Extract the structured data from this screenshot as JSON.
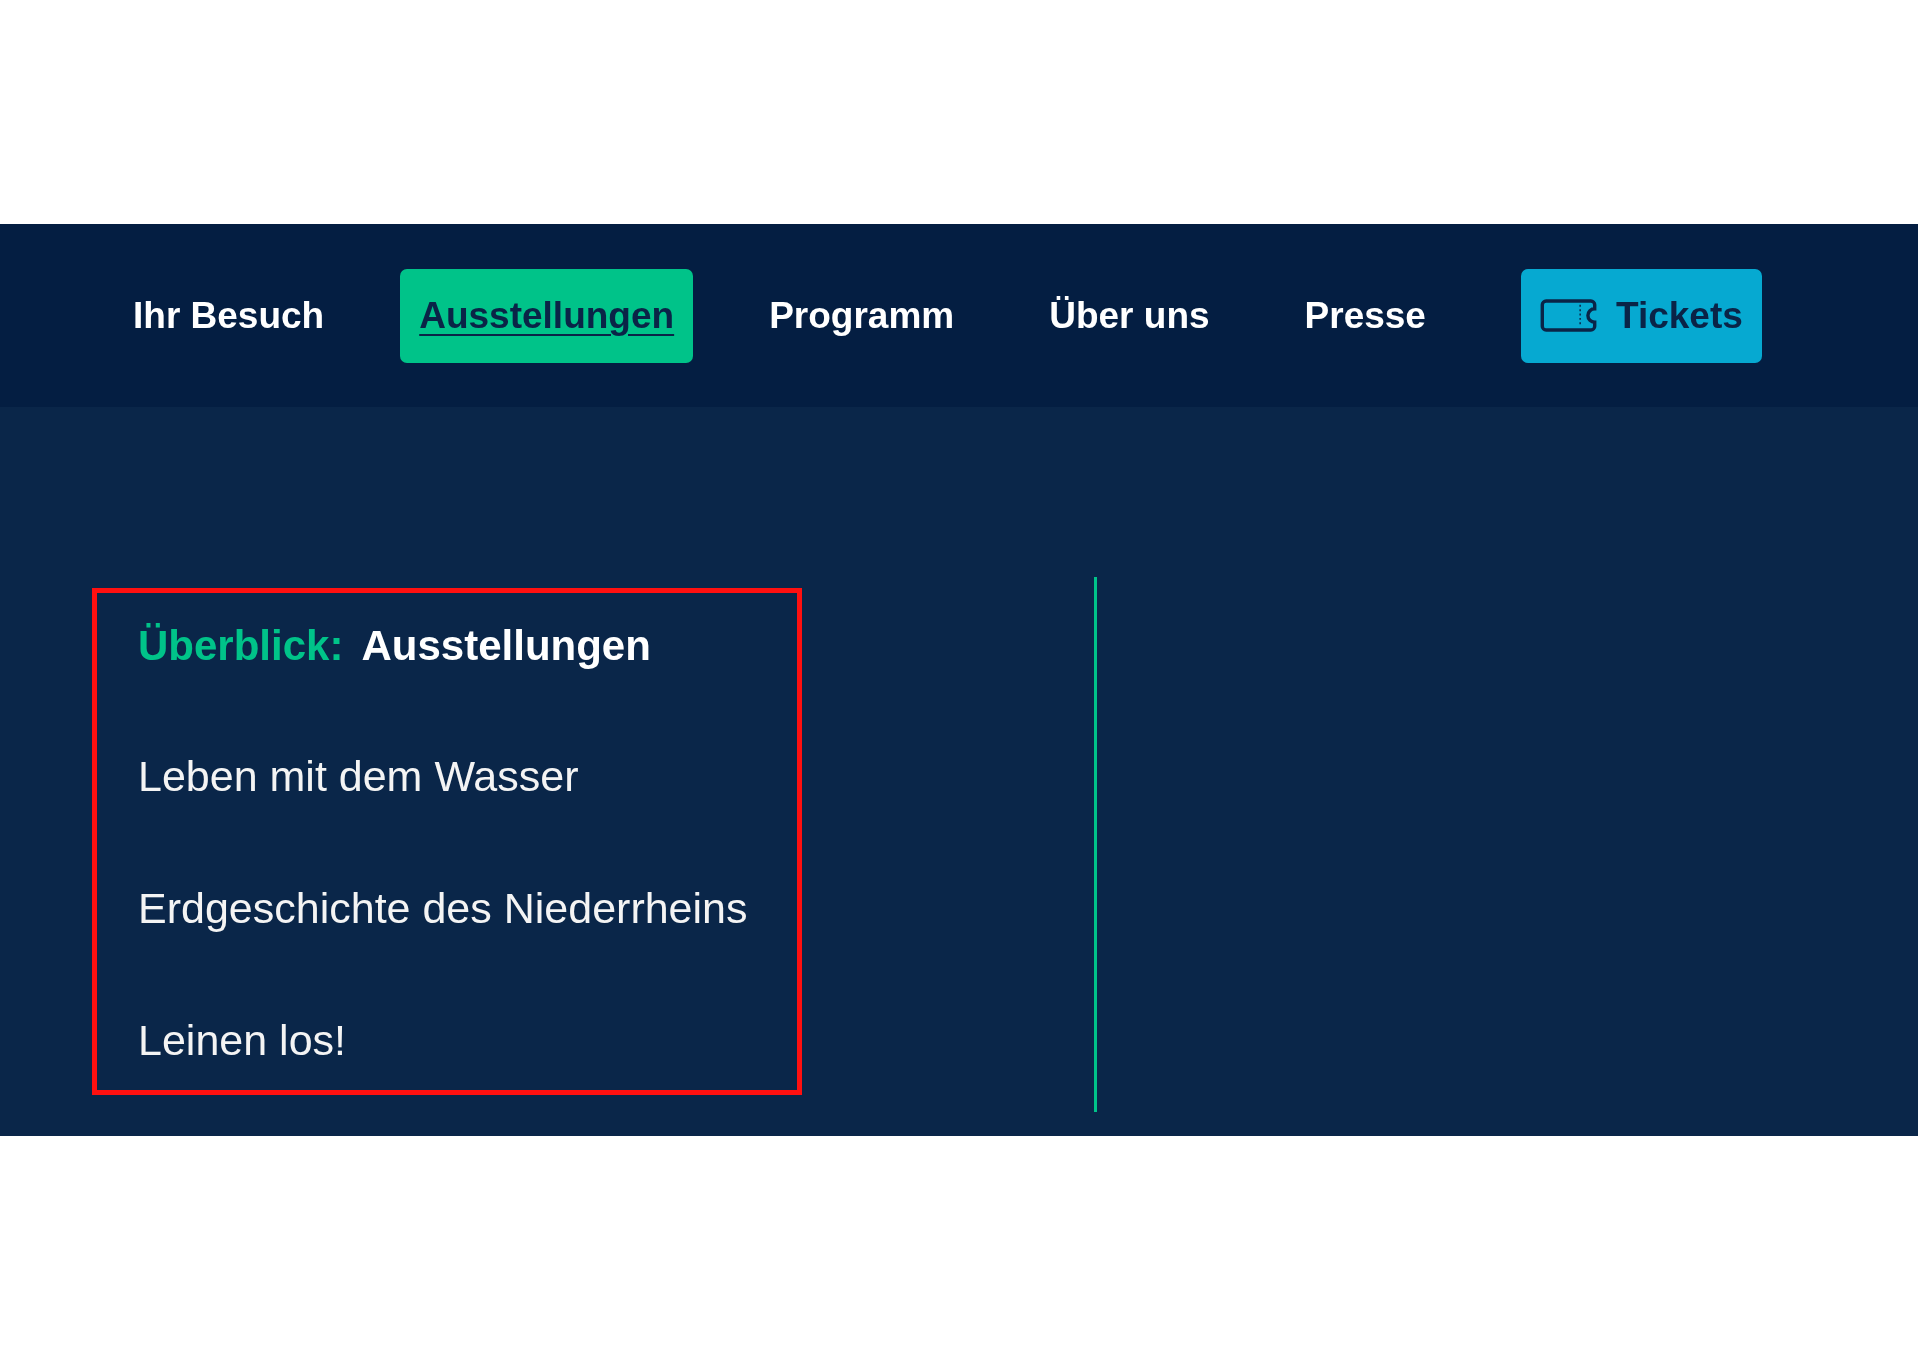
{
  "nav": {
    "items": [
      {
        "label": "Ihr Besuch",
        "selected": false
      },
      {
        "label": "Ausstellungen",
        "selected": true
      },
      {
        "label": "Programm",
        "selected": false
      },
      {
        "label": "Über uns",
        "selected": false
      },
      {
        "label": "Presse",
        "selected": false
      }
    ]
  },
  "tickets_button": {
    "label": "Tickets"
  },
  "submenu": {
    "highlighted": true,
    "overview": {
      "prefix": "Überblick:",
      "label": "Ausstellungen"
    },
    "links": [
      "Leben mit dem Wasser",
      "Erdgeschichte des Niederrheins",
      "Leinen los!"
    ]
  }
}
